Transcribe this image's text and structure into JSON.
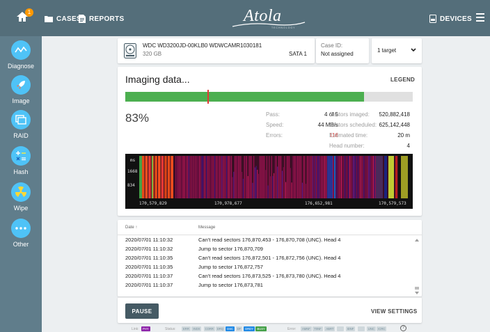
{
  "topbar": {
    "notification_count": "1",
    "nav_cases": "CASES",
    "nav_reports": "REPORTS",
    "logo": "Atola",
    "logo_sub": "TECHNOLOGY",
    "devices": "DEVICES"
  },
  "sidebar": {
    "items": [
      {
        "label": "Diagnose",
        "icon": "pulse-icon"
      },
      {
        "label": "Image",
        "icon": "rocket-icon"
      },
      {
        "label": "RAID",
        "icon": "stack-icon"
      },
      {
        "label": "Hash",
        "icon": "calculator-icon"
      },
      {
        "label": "Wipe",
        "icon": "radiation-icon"
      },
      {
        "label": "Other",
        "icon": "more-dots-icon"
      }
    ]
  },
  "drive": {
    "name": "WDC WD3200JD-00KLB0 WDWCAMR1030181",
    "size": "320 GB",
    "port": "SATA 1"
  },
  "case": {
    "label": "Case ID:",
    "value": "Not assigned"
  },
  "target": {
    "label": "1 target"
  },
  "imaging": {
    "title": "Imaging data...",
    "legend": "LEGEND",
    "progress_fraction": 0.83,
    "marker_fraction": 0.285,
    "percent": "83%",
    "stats_left": [
      {
        "label": "Pass:",
        "value": "4 of 5"
      },
      {
        "label": "Speed:",
        "value": "44 MB/s"
      },
      {
        "label": "Errors:",
        "value": "116",
        "error": true
      }
    ],
    "stats_right": [
      {
        "label": "Sectors imaged:",
        "value": "520,882,418"
      },
      {
        "label": "Sectors scheduled:",
        "value": "625,142,448"
      },
      {
        "label": "Estimated time:",
        "value": "20 m"
      },
      {
        "label": "Head number:",
        "value": "4"
      }
    ],
    "heatmap": {
      "y_unit": "ms",
      "y_ticks": [
        "1668",
        "834"
      ],
      "x_ticks": [
        "170,579,829",
        "170,978,677",
        "176,652,981",
        "170,579,573"
      ]
    }
  },
  "log": {
    "col_date": "Date ↑",
    "col_message": "Message",
    "rows": [
      {
        "date": "2020/07/01 11:10:32",
        "message": "Can't read sectors 176,870,453 - 176,870,708 (UNC). Head 4"
      },
      {
        "date": "2020/07/01 11:10:32",
        "message": "Jump to sector 176,870,709"
      },
      {
        "date": "2020/07/01 11:10:35",
        "message": "Can't read sectors 176,872,501 - 176,872,756 (UNC). Head 4"
      },
      {
        "date": "2020/07/01 11:10:35",
        "message": "Jump to sector 176,872,757"
      },
      {
        "date": "2020/07/01 11:10:37",
        "message": "Can't read sectors 176,873,525 - 176,873,780 (UNC). Head 4"
      },
      {
        "date": "2020/07/01 11:10:37",
        "message": "Jump to sector 176,873,781"
      }
    ]
  },
  "actions": {
    "pause": "PAUSE",
    "view_settings": "VIEW SETTINGS"
  },
  "status": {
    "link_label": "Link:",
    "link_value": "PHY",
    "status_label": "Status:",
    "status_chips": [
      {
        "text": "ERR",
        "state": "off"
      },
      {
        "text": "INDX",
        "state": "off"
      },
      {
        "text": "CORR",
        "state": "off"
      },
      {
        "text": "DRQ",
        "state": "off"
      },
      {
        "text": "DSC",
        "state": "blue"
      },
      {
        "text": "DF",
        "state": "off"
      },
      {
        "text": "DRDY",
        "state": "blue"
      },
      {
        "text": "BUSY",
        "state": "green"
      }
    ],
    "error_label": "Error:",
    "error_chips": [
      "AMNF",
      "T0NF",
      "ABRT",
      "",
      "IDNF",
      "",
      "UNC",
      "ICRC"
    ],
    "help": "?"
  },
  "colors": {
    "topbar": "#546e7a",
    "sidebar": "#607d8b",
    "accent": "#4fc3f7",
    "progress": "#4caf50",
    "error": "#e53935"
  }
}
